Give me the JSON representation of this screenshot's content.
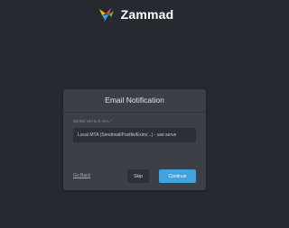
{
  "brand": {
    "name": "Zammad",
    "logo_icon": "zammad-bird-logo",
    "colors": [
      "#f0c000",
      "#e0483e",
      "#3fa4d9",
      "#6fbd4a"
    ]
  },
  "card": {
    "title": "Email Notification",
    "field": {
      "label": "SEND MAILS VIA",
      "required_marker": "*",
      "selected_value": "Local MTA (Sendmail/Postfix/Exim/...) - use serve"
    },
    "footer": {
      "back_label": "Go Back",
      "skip_label": "Skip",
      "continue_label": "Continue"
    }
  },
  "colors": {
    "background": "#26292f",
    "card": "#3c3f45",
    "primary_button": "#40a3de"
  }
}
